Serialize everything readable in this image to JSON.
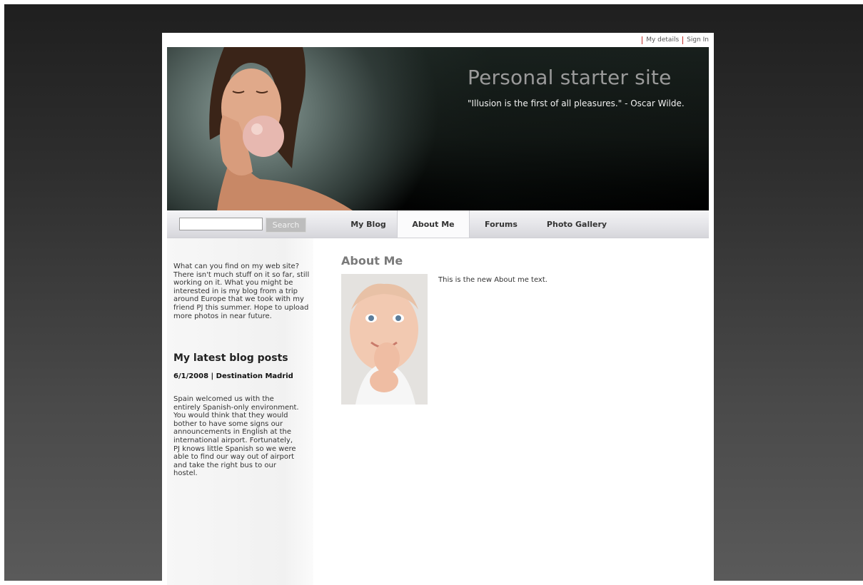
{
  "top_links": [
    "My details",
    "Sign In"
  ],
  "header": {
    "title": "Personal starter site",
    "quote": "\"Illusion is the first of all pleasures.\" - Oscar Wilde."
  },
  "search": {
    "placeholder": "",
    "button_label": "Search"
  },
  "nav": [
    "My Blog",
    "About Me",
    "Forums",
    "Photo Gallery"
  ],
  "sidebar": {
    "intro": "What can you find on my web site? There isn't much stuff on it so far, still working on it. What you might be interested in is my blog from a trip around Europe that we took with my friend PJ this summer. Hope to upload more photos in near future.",
    "heading": "My latest blog posts",
    "post_title": "6/1/2008 | Destination Madrid",
    "post_body": "Spain welcomed us with the entirely Spanish-only environment. You would think that they would bother to have some signs our announcements in English at the international airport. Fortunately, PJ knows little Spanish so we were able to find our way out of airport and take the right bus to our hostel."
  },
  "main": {
    "title": "About Me",
    "text": "This is the new About me text."
  },
  "colors": {
    "nav_active": "#fbfbfc",
    "title_gray": "#9a9a9a",
    "link_sep": "#c0302a"
  }
}
